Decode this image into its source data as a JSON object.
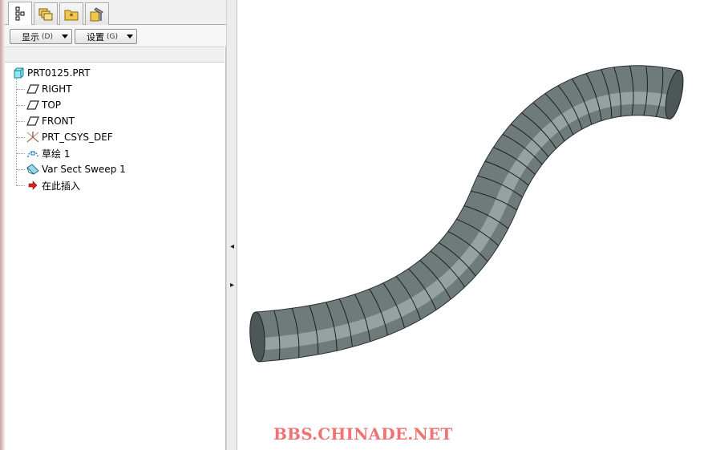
{
  "navigator": {
    "tabs": [
      {
        "icon": "model-tree-icon"
      },
      {
        "icon": "layers-icon"
      },
      {
        "icon": "favorites-folder-icon"
      },
      {
        "icon": "connections-icon"
      }
    ],
    "toolbar": {
      "show_label": "显示",
      "show_key": "(D)",
      "settings_label": "设置",
      "settings_key": "(G)"
    },
    "tree": {
      "root": {
        "label": "PRT0125.PRT",
        "icon": "part-icon"
      },
      "items": [
        {
          "label": "RIGHT",
          "icon": "datum-plane-icon"
        },
        {
          "label": "TOP",
          "icon": "datum-plane-icon"
        },
        {
          "label": "FRONT",
          "icon": "datum-plane-icon"
        },
        {
          "label": "PRT_CSYS_DEF",
          "icon": "coordinate-system-icon"
        },
        {
          "label": "草绘 1",
          "icon": "sketch-icon"
        },
        {
          "label": "Var Sect Sweep 1",
          "icon": "variable-section-sweep-icon"
        },
        {
          "label": "在此插入",
          "icon": "insert-here-arrow-icon"
        }
      ]
    }
  },
  "splitter": {
    "collapse_icon": "collapse-left-icon",
    "expand_icon": "expand-right-icon"
  },
  "graphics": {
    "model": "variable-section-sweep-tube",
    "colors": {
      "tube": "#6f7b7b",
      "tube_highlight": "#b7c2c2",
      "ring_line": "#1a1f1f"
    },
    "watermark": "BBS.CHINADE.NET",
    "watermark_color": "#ef7373"
  }
}
